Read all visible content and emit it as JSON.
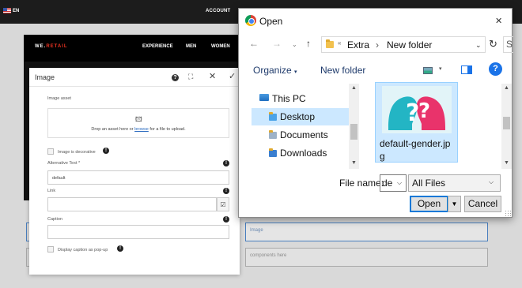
{
  "site": {
    "language": "EN",
    "account_label": "ACCOUNT",
    "brand_pre": "WE.",
    "brand_accent": "RETAIL",
    "nav": [
      "EXPERIENCE",
      "MEN",
      "WOMEN"
    ],
    "slot_selected_label": "Image",
    "slot_placeholder_label": "components here"
  },
  "image_dialog": {
    "title": "Image",
    "header_icons": [
      "help-icon",
      "fullscreen-icon",
      "close-icon",
      "check-icon"
    ],
    "asset_label": "Image asset",
    "drop_text_before": "Drop an asset here or ",
    "drop_link": "browse",
    "drop_text_after": " for a file to upload.",
    "decorative_label": "Image is decorative",
    "alt_label": "Alternative Text *",
    "alt_value": "default",
    "link_label": "Link",
    "link_value": "",
    "caption_label": "Caption",
    "caption_value": "",
    "popup_label": "Display caption as pop-up"
  },
  "open_dialog": {
    "title": "Open",
    "path": [
      "Extra",
      "New folder"
    ],
    "search_edge": "S",
    "toolbar": {
      "organize": "Organize",
      "new_folder": "New folder"
    },
    "tree": [
      "This PC",
      "Desktop",
      "Documents",
      "Downloads"
    ],
    "selected_tree_item": "Desktop",
    "file": {
      "name_line1": "default-gender.jp",
      "name_line2": "g"
    },
    "file_name_label": "File name:",
    "file_name_value": "de",
    "filter_value": "All Files",
    "open_button": "Open",
    "cancel_button": "Cancel"
  },
  "colors": {
    "accent_blue": "#0078d7",
    "selection": "#cce8ff",
    "brand_red": "#e32"
  }
}
